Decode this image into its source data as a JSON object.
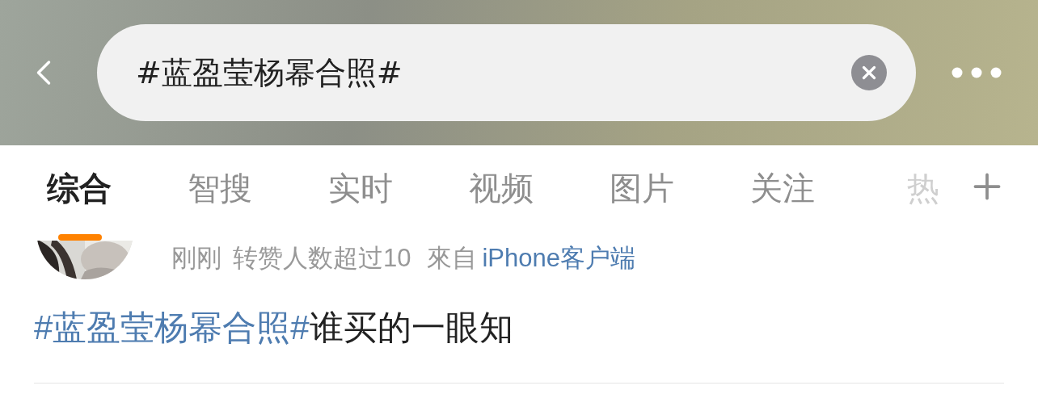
{
  "search": {
    "value": "#蓝盈莹杨幂合照#"
  },
  "tabs": [
    {
      "label": "综合",
      "selected": true
    },
    {
      "label": "智搜",
      "selected": false
    },
    {
      "label": "实时",
      "selected": false
    },
    {
      "label": "视频",
      "selected": false
    },
    {
      "label": "图片",
      "selected": false
    },
    {
      "label": "关注",
      "selected": false
    },
    {
      "label": "热",
      "selected": false
    }
  ],
  "post": {
    "time": "刚刚",
    "stats": "转赞人数超过10",
    "source_prefix": "來自",
    "source": "iPhone客户端",
    "topic": "#蓝盈莹杨幂合照#",
    "text": "谁买的一眼知"
  }
}
